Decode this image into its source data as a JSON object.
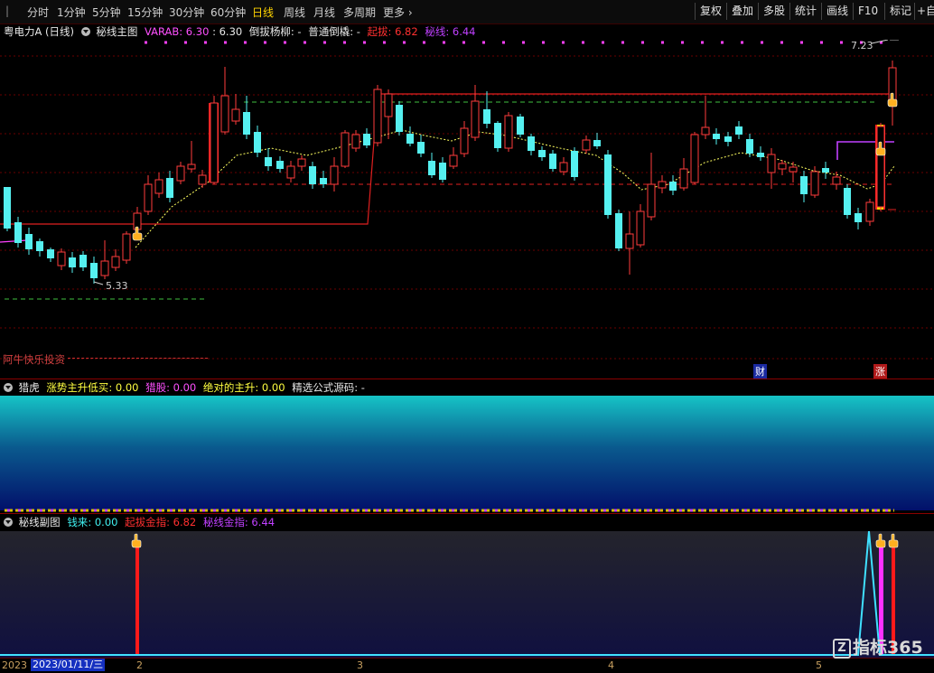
{
  "toolbar": {
    "periods": [
      "分时",
      "1分钟",
      "5分钟",
      "15分钟",
      "30分钟",
      "60分钟",
      "日线",
      "周线",
      "月线",
      "多周期",
      "更多"
    ],
    "more_arrow": "›",
    "active_period": "日线",
    "right_buttons": [
      "复权",
      "叠加",
      "多股",
      "统计",
      "画线",
      "F10",
      "标记",
      "+自"
    ]
  },
  "main_panel": {
    "stock": "粤电力A",
    "period": "(日线)",
    "indicator": "秘线主图",
    "varab_label": "VARAB",
    "varab_value": ": 6.30",
    "varab_value2": ": 6.30",
    "daoba_label": "倒拔杨柳",
    "daoba_value": ": -",
    "putong_label": "普通倒橇",
    "putong_value": ": -",
    "qiba_label": "起拔",
    "qiba_value": ": 6.82",
    "mixian_label": "秘线",
    "mixian_value": ": 6.44",
    "high_label": "7.23",
    "low_label": "5.33",
    "watermark": "阿牛快乐投资",
    "badge_cai": "财",
    "badge_zhang": "涨"
  },
  "mid_panel": {
    "name": "猎虎",
    "l1": "涨势主升低买",
    "v1": ": 0.00",
    "l2": "猎股",
    "v2": ": 0.00",
    "l3": "绝对的主升",
    "v3": ": 0.00",
    "l4": "精选公式源码",
    "v4": ": -"
  },
  "bottom_panel": {
    "name": "秘线副图",
    "l1": "钱来",
    "v1": ": 0.00",
    "l2": "起拔金指",
    "v2": ": 6.82",
    "l3": "秘线金指",
    "v3": ": 6.44"
  },
  "date_axis": {
    "year": "2023",
    "cursor_date": "2023/01/11/三",
    "ticks": [
      "2",
      "3",
      "4",
      "5"
    ]
  },
  "logo": {
    "text": "指标365"
  },
  "colors": {
    "up": "#ff3b3b",
    "down": "#55f0f0",
    "accent": "#ffd400",
    "purple": "#c040ff"
  }
}
